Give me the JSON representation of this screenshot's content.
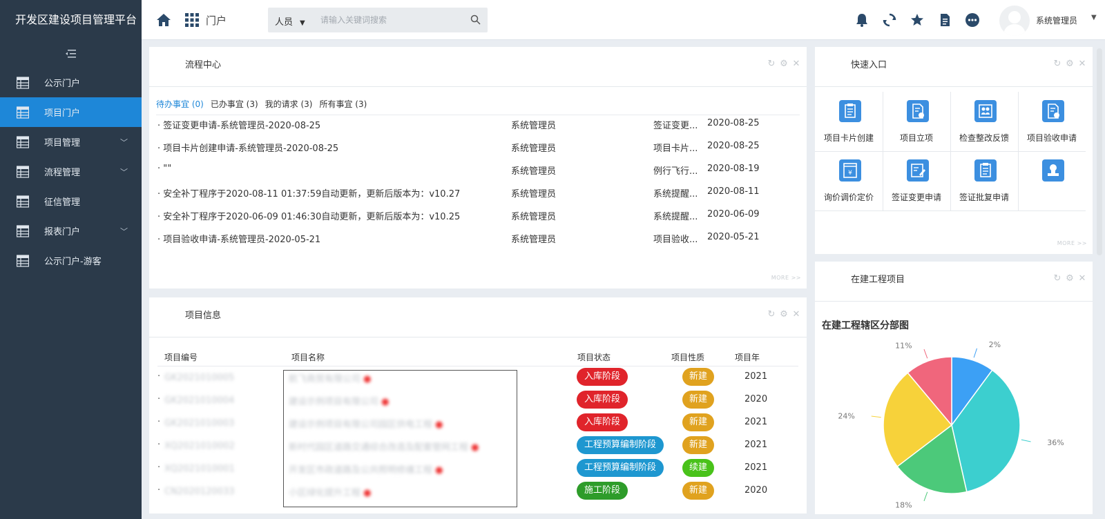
{
  "app": {
    "title": "开发区建设项目管理平台",
    "collapse_icon": "menu-collapse-icon"
  },
  "sidebar": {
    "items": [
      {
        "label": "公示门户",
        "icon": "table-icon",
        "has_children": false,
        "active": false
      },
      {
        "label": "项目门户",
        "icon": "table-icon",
        "has_children": false,
        "active": true
      },
      {
        "label": "项目管理",
        "icon": "table-icon",
        "has_children": true,
        "active": false
      },
      {
        "label": "流程管理",
        "icon": "table-icon",
        "has_children": true,
        "active": false
      },
      {
        "label": "征信管理",
        "icon": "table-icon",
        "has_children": false,
        "active": false
      },
      {
        "label": "报表门户",
        "icon": "table-icon",
        "has_children": true,
        "active": false
      },
      {
        "label": "公示门户-游客",
        "icon": "table-icon",
        "has_children": false,
        "active": false
      }
    ]
  },
  "header": {
    "portal_label": "门户",
    "search": {
      "scope": "人员",
      "placeholder": "请输入关键词搜索"
    },
    "icons": [
      "bell-icon",
      "sync-icon",
      "star-icon",
      "document-icon",
      "more-icon"
    ],
    "user_name": "系统管理员"
  },
  "process_center": {
    "title": "流程中心",
    "tabs": [
      "待办事宜 (0)",
      "已办事宜 (3)",
      "我的请求 (3)",
      "所有事宜 (3)"
    ],
    "rows": [
      {
        "title": "签证变更申请-系统管理员-2020-08-25",
        "user": "系统管理员",
        "type": "签证变更...",
        "date": "2020-08-25"
      },
      {
        "title": "项目卡片创建申请-系统管理员-2020-08-25",
        "user": "系统管理员",
        "type": "项目卡片...",
        "date": "2020-08-25"
      },
      {
        "title": "\"\"",
        "user": "系统管理员",
        "type": "例行飞行...",
        "date": "2020-08-19"
      },
      {
        "title": "安全补丁程序于2020-08-11 01:37:59自动更新，更新后版本为：v10.27",
        "user": "系统管理员",
        "type": "系统提醒...",
        "date": "2020-08-11"
      },
      {
        "title": "安全补丁程序于2020-06-09 01:46:30自动更新，更新后版本为：v10.25",
        "user": "系统管理员",
        "type": "系统提醒...",
        "date": "2020-06-09"
      },
      {
        "title": "项目验收申请-系统管理员-2020-05-21",
        "user": "系统管理员",
        "type": "项目验收...",
        "date": "2020-05-21"
      }
    ],
    "more": "MORE >>"
  },
  "project_info": {
    "title": "项目信息",
    "headers": {
      "code": "项目编号",
      "name": "项目名称",
      "status": "项目状态",
      "nature": "项目性质",
      "year": "项目年"
    },
    "rows": [
      {
        "code": "GK2021010005",
        "name": "航飞商贸有限公司",
        "status": "入库阶段",
        "status_color": "#e0242b",
        "nature": "新建",
        "nature_color": "#e0a21f",
        "year": "2021"
      },
      {
        "code": "GK2021010004",
        "name": "建设示例项目有限公司",
        "status": "入库阶段",
        "status_color": "#e0242b",
        "nature": "新建",
        "nature_color": "#e0a21f",
        "year": "2020"
      },
      {
        "code": "GK2021010003",
        "name": "建设示例项目有限公司园区供电工程",
        "status": "入库阶段",
        "status_color": "#e0242b",
        "nature": "新建",
        "nature_color": "#e0a21f",
        "year": "2021"
      },
      {
        "code": "XQ2021010002",
        "name": "新时代园区道路交通综合改造及配套管网工程",
        "status": "工程预算编制阶段",
        "status_color": "#1e97d0",
        "nature": "新建",
        "nature_color": "#e0a21f",
        "year": "2021"
      },
      {
        "code": "XQ2021010001",
        "name": "开发区市政道路及公共照明修缮工程",
        "status": "工程预算编制阶段",
        "status_color": "#1e97d0",
        "nature": "续建",
        "nature_color": "#49c21a",
        "year": "2021"
      },
      {
        "code": "CN2020120033",
        "name": "小区绿化提升工程",
        "status": "施工阶段",
        "status_color": "#2e9c2a",
        "nature": "新建",
        "nature_color": "#e0a21f",
        "year": "2020"
      }
    ]
  },
  "quick_entry": {
    "title": "快速入口",
    "items": [
      {
        "label": "项目卡片创建",
        "icon": "clipboard-icon"
      },
      {
        "label": "项目立项",
        "icon": "document-check-icon"
      },
      {
        "label": "检查整改反馈",
        "icon": "team-icon"
      },
      {
        "label": "项目验收申请",
        "icon": "document-check-icon"
      },
      {
        "label": "询价调价定价",
        "icon": "yuan-icon"
      },
      {
        "label": "签证变更申请",
        "icon": "edit-icon"
      },
      {
        "label": "签证批复申请",
        "icon": "clipboard-icon"
      },
      {
        "label": "",
        "icon": "stamp-icon"
      }
    ],
    "more": "MORE >>"
  },
  "construction": {
    "title": "在建工程项目"
  },
  "chart_data": {
    "type": "pie",
    "title": "在建工程辖区分部图",
    "slices": [
      {
        "label": "",
        "percent_label": "2%",
        "value": 10,
        "color": "#3ca0f5"
      },
      {
        "label": "",
        "percent_label": "36%",
        "value": 36,
        "color": "#3ccfcf"
      },
      {
        "label": "",
        "percent_label": "18%",
        "value": 18,
        "color": "#4cc97a"
      },
      {
        "label": "",
        "percent_label": "24%",
        "value": 24,
        "color": "#f7d23a"
      },
      {
        "label": "",
        "percent_label": "11%",
        "value": 11,
        "color": "#f0667c"
      }
    ]
  },
  "colors": {
    "sidebar_bg": "#2b3a4a",
    "active": "#1e87d8",
    "accent": "#1e87d8"
  }
}
